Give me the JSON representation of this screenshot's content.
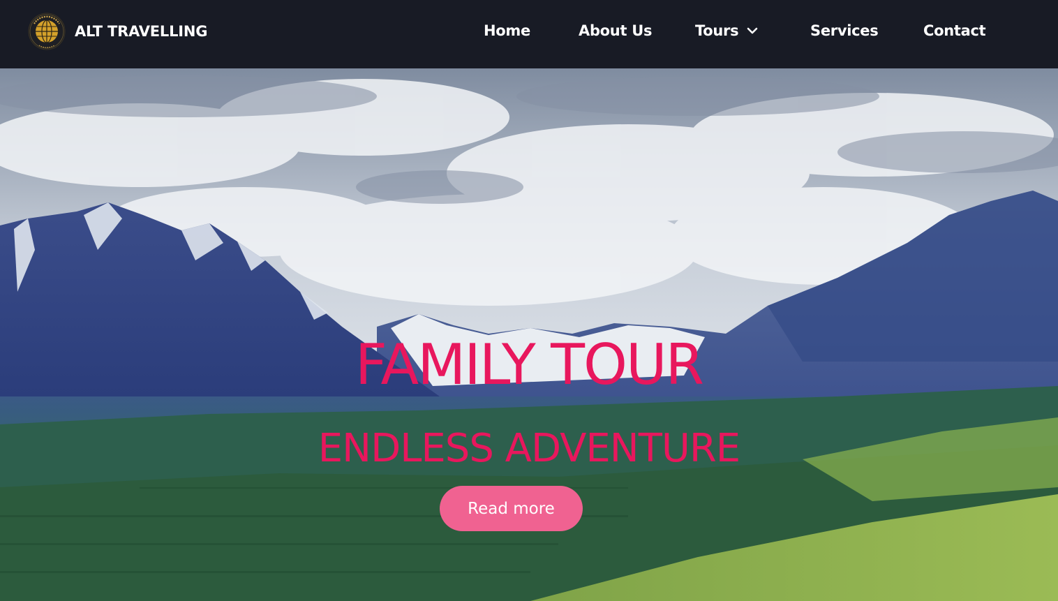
{
  "brand": {
    "name": "ALT TRAVELLING",
    "logo_icon": "globe-logo-icon",
    "logo_ring_text": "ALT TRAVELS"
  },
  "nav": {
    "items": [
      {
        "label": "Home"
      },
      {
        "label": "About Us"
      },
      {
        "label": "Tours",
        "has_dropdown": true,
        "dropdown_icon": "chevron-down-icon"
      },
      {
        "label": "Services"
      },
      {
        "label": "Contact"
      }
    ]
  },
  "hero": {
    "title": "FAMILY TOUR",
    "subtitle": "ENDLESS ADVENTURE",
    "button_label": "Read more",
    "background": "mountain-landscape-image"
  },
  "colors": {
    "navbar_bg": "#181b25",
    "accent": "#e8175d",
    "button_bg": "#f06291",
    "nav_text": "#ffffff"
  }
}
